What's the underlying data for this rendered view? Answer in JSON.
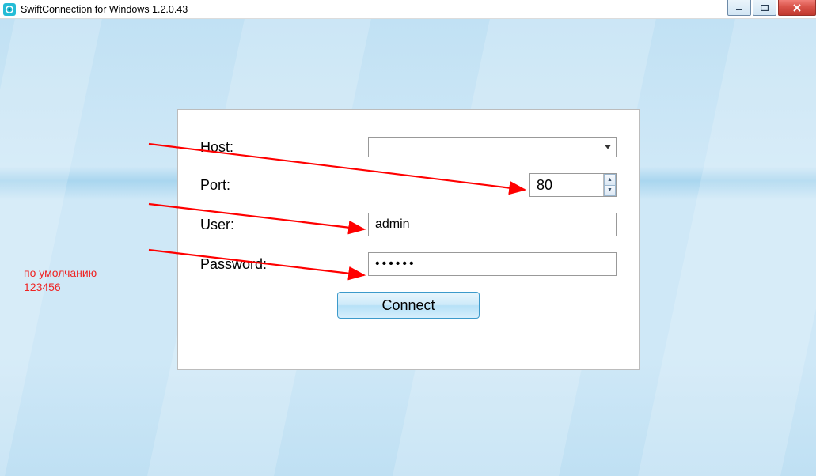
{
  "window": {
    "title": "SwiftConnection for Windows 1.2.0.43"
  },
  "form": {
    "host_label": "Host:",
    "host_value": "",
    "port_label": "Port:",
    "port_value": "80",
    "user_label": "User:",
    "user_value": "admin",
    "password_label": "Password:",
    "password_display": "••••••",
    "connect_label": "Connect"
  },
  "annotation": {
    "line1": "по умолчанию",
    "line2": "123456"
  }
}
